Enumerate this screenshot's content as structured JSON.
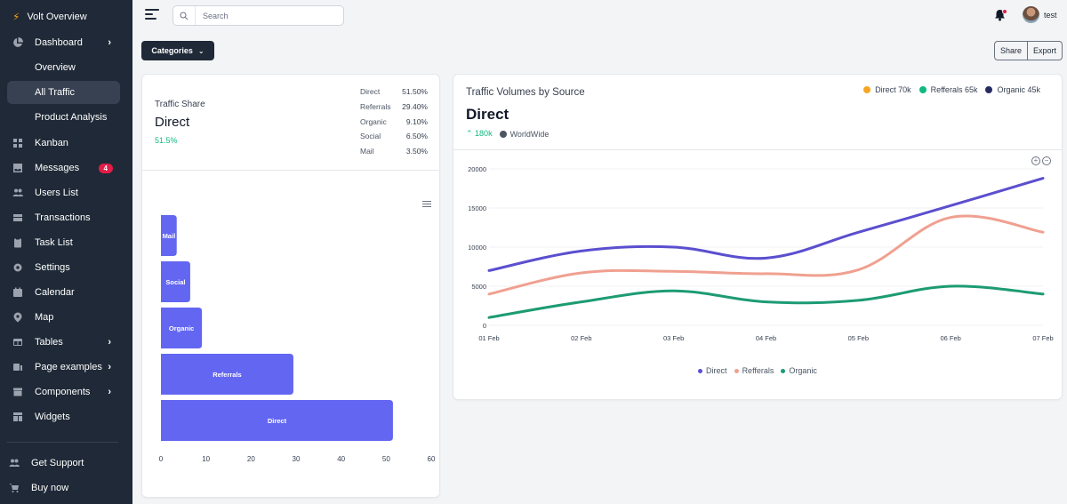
{
  "sidebar": {
    "brand": "Volt Overview",
    "items": [
      {
        "label": "Dashboard",
        "icon": "chart-pie-icon",
        "has_children": true
      },
      {
        "label": "Overview",
        "sub": true
      },
      {
        "label": "All Traffic",
        "sub": true,
        "active": true
      },
      {
        "label": "Product Analysis",
        "sub": true
      },
      {
        "label": "Kanban",
        "icon": "view-grid-icon"
      },
      {
        "label": "Messages",
        "icon": "inbox-icon",
        "badge": "4"
      },
      {
        "label": "Users List",
        "icon": "users-icon"
      },
      {
        "label": "Transactions",
        "icon": "credit-card-icon"
      },
      {
        "label": "Task List",
        "icon": "clipboard-list-icon"
      },
      {
        "label": "Settings",
        "icon": "cog-icon"
      },
      {
        "label": "Calendar",
        "icon": "calendar-icon"
      },
      {
        "label": "Map",
        "icon": "location-marker-icon"
      },
      {
        "label": "Tables",
        "icon": "table-icon",
        "has_children": true
      },
      {
        "label": "Page examples",
        "icon": "document-icon",
        "has_children": true
      },
      {
        "label": "Components",
        "icon": "archive-icon",
        "has_children": true
      },
      {
        "label": "Widgets",
        "icon": "template-icon"
      }
    ],
    "footer": [
      {
        "label": "Get Support",
        "icon": "support-icon"
      },
      {
        "label": "Buy now",
        "icon": "shopping-cart-icon"
      }
    ]
  },
  "topbar": {
    "search_placeholder": "Search",
    "search_value": "",
    "user_name": "test",
    "notification_dot": true
  },
  "toolbar": {
    "categories_label": "Categories",
    "share_label": "Share",
    "export_label": "Export"
  },
  "traffic_share": {
    "subtitle": "Traffic Share",
    "title": "Direct",
    "percent": "51.5%",
    "rows": [
      {
        "label": "Direct",
        "value": "51.50%"
      },
      {
        "label": "Referrals",
        "value": "29.40%"
      },
      {
        "label": "Organic",
        "value": "9.10%"
      },
      {
        "label": "Social",
        "value": "6.50%"
      },
      {
        "label": "Mail",
        "value": "3.50%"
      }
    ]
  },
  "traffic_volumes": {
    "subtitle": "Traffic Volumes by Source",
    "title": "Direct",
    "change": "180k",
    "region": "WorldWide",
    "summary_legend": [
      {
        "label": "Direct 70k",
        "color": "#f5a623"
      },
      {
        "label": "Refferals 65k",
        "color": "#10b981"
      },
      {
        "label": "Organic 45k",
        "color": "#262b63"
      }
    ]
  },
  "chart_data": [
    {
      "type": "bar",
      "orientation": "horizontal",
      "title": "",
      "categories": [
        "Mail",
        "Social",
        "Organic",
        "Referrals",
        "Direct"
      ],
      "values": [
        3.5,
        6.5,
        9.1,
        29.4,
        51.5
      ],
      "xlim": [
        0,
        60
      ],
      "xticks": [
        "0",
        "10",
        "20",
        "30",
        "40",
        "50",
        "60"
      ],
      "color": "#6366f1",
      "data_labels": "category names inside bars"
    },
    {
      "type": "line",
      "title": "",
      "x": [
        "01 Feb",
        "02 Feb",
        "03 Feb",
        "04 Feb",
        "05 Feb",
        "06 Feb",
        "07 Feb"
      ],
      "ylim": [
        0,
        20000
      ],
      "yticks": [
        "0",
        "5000",
        "10000",
        "15000",
        "20000"
      ],
      "grid": true,
      "legend": "bottom-center",
      "series": [
        {
          "name": "Direct",
          "color": "#5b4fcf",
          "values": [
            7000,
            9500,
            10000,
            8600,
            11900,
            15300,
            18800
          ]
        },
        {
          "name": "Refferals",
          "color": "#f0a090",
          "values": [
            4000,
            6700,
            6900,
            6600,
            7100,
            13800,
            11900
          ]
        },
        {
          "name": "Organic",
          "color": "#1d9b73",
          "values": [
            1000,
            3000,
            4400,
            3000,
            3200,
            5000,
            4000
          ]
        }
      ]
    }
  ]
}
